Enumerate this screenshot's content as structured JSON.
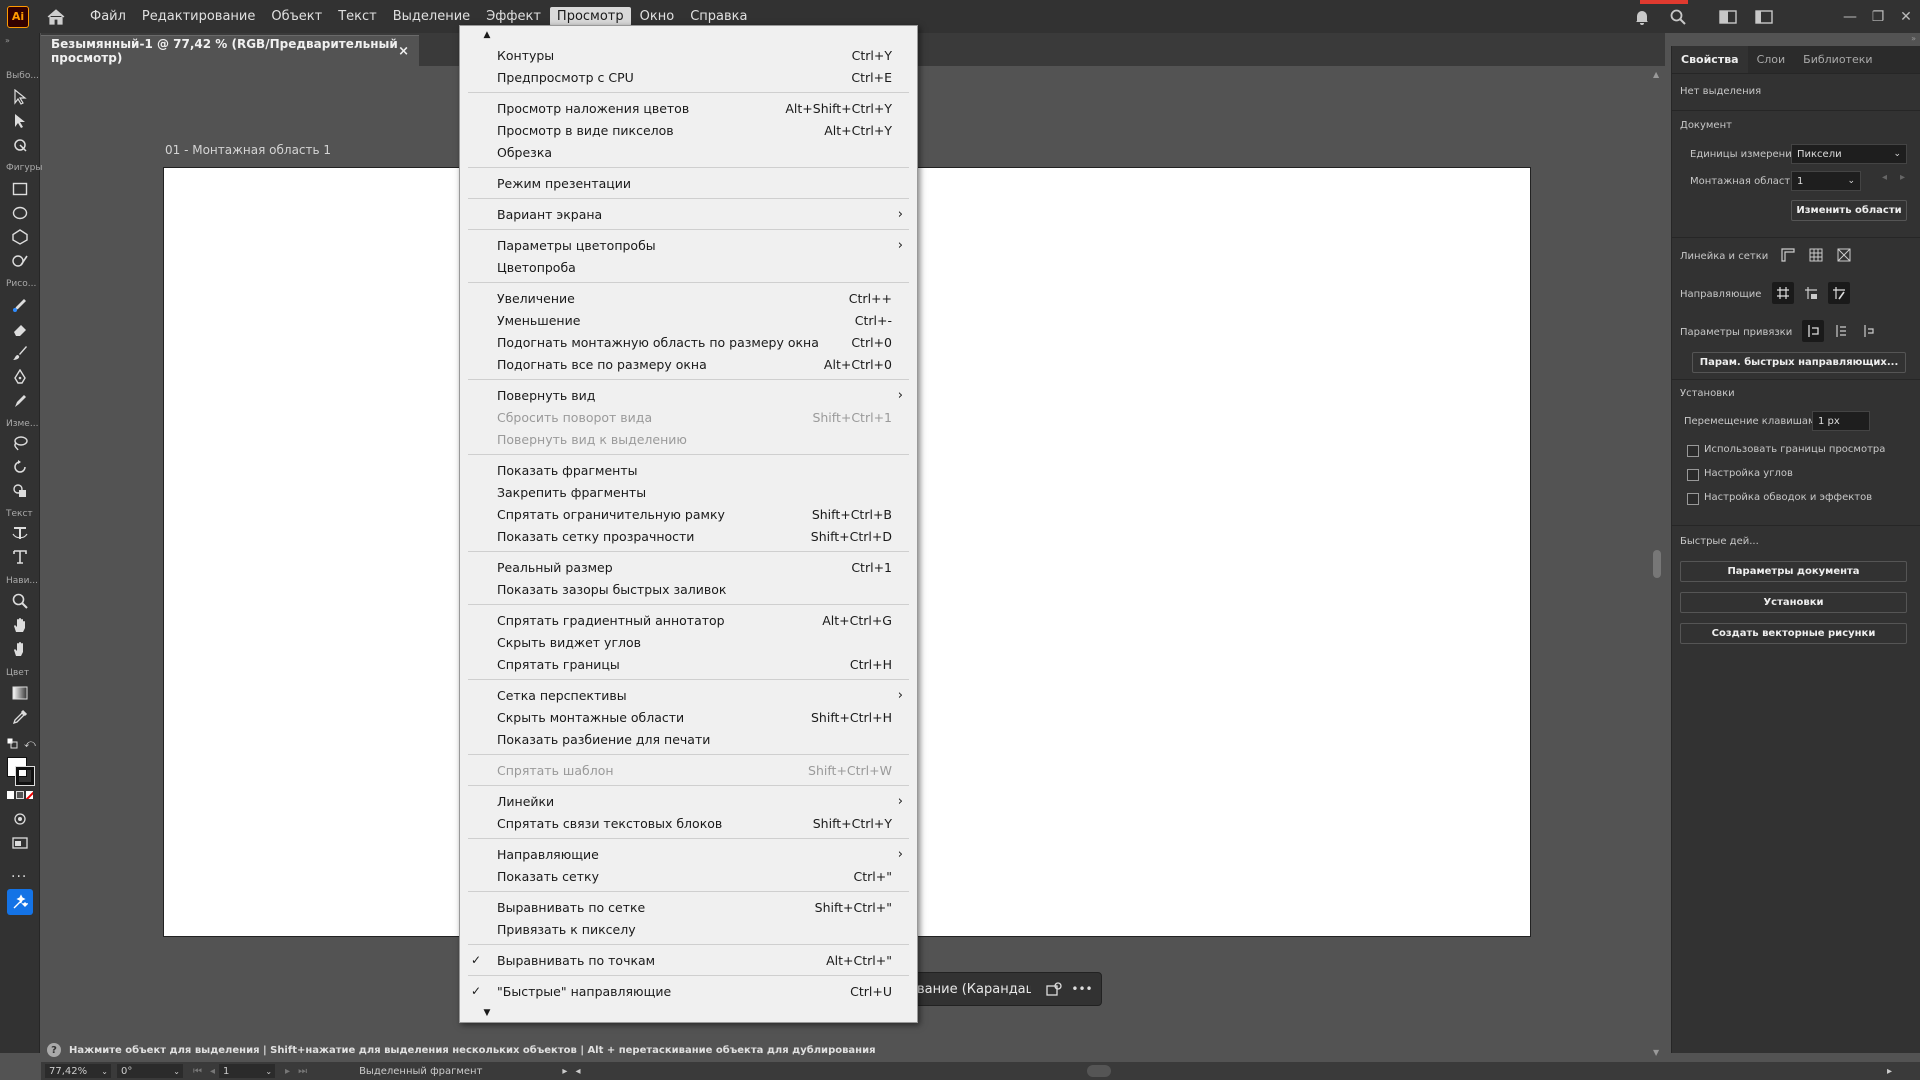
{
  "app": {
    "logo": "Ai",
    "menu": [
      "Файл",
      "Редактирование",
      "Объект",
      "Текст",
      "Выделение",
      "Эффект",
      "Просмотр",
      "Окно",
      "Справка"
    ],
    "active_menu_index": 6,
    "accent_color": "#ff9a00"
  },
  "document": {
    "tab_title": "Безымянный-1 @ 77,42 % (RGB/Предварительный просмотр)",
    "tab_close": "×",
    "artboard_label": "01 - Монтажная область 1"
  },
  "toolbar": {
    "sections": [
      "Выбо...",
      "Фигуры",
      "Рисо...",
      "Изме...",
      "Текст",
      "Нави...",
      "Цвет"
    ],
    "more": "..."
  },
  "task_bar": {
    "label": "вание (Карандаш)",
    "more": "•••"
  },
  "view_menu": {
    "items": [
      {
        "label": "Контуры",
        "shortcut": "Ctrl+Y"
      },
      {
        "label": "Предпросмотр с CPU",
        "shortcut": "Ctrl+E"
      },
      {
        "label": "Просмотр наложения цветов",
        "shortcut": "Alt+Shift+Ctrl+Y"
      },
      {
        "label": "Просмотр в виде пикселов",
        "shortcut": "Alt+Ctrl+Y"
      },
      {
        "label": "Обрезка",
        "shortcut": ""
      },
      {
        "label": "Режим презентации",
        "shortcut": ""
      },
      {
        "label": "Вариант экрана",
        "shortcut": "",
        "submenu": true
      },
      {
        "label": "Параметры цветопробы",
        "shortcut": "",
        "submenu": true
      },
      {
        "label": "Цветопроба",
        "shortcut": ""
      },
      {
        "label": "Увеличение",
        "shortcut": "Ctrl++"
      },
      {
        "label": "Уменьшение",
        "shortcut": "Ctrl+-"
      },
      {
        "label": "Подогнать монтажную область по размеру окна",
        "shortcut": "Ctrl+0"
      },
      {
        "label": "Подогнать все по размеру окна",
        "shortcut": "Alt+Ctrl+0"
      },
      {
        "label": "Повернуть вид",
        "shortcut": "",
        "submenu": true
      },
      {
        "label": "Сбросить поворот вида",
        "shortcut": "Shift+Ctrl+1",
        "disabled": true
      },
      {
        "label": "Повернуть вид к выделению",
        "shortcut": "",
        "disabled": true
      },
      {
        "label": "Показать фрагменты",
        "shortcut": ""
      },
      {
        "label": "Закрепить фрагменты",
        "shortcut": ""
      },
      {
        "label": "Спрятать ограничительную рамку",
        "shortcut": "Shift+Ctrl+B"
      },
      {
        "label": "Показать сетку прозрачности",
        "shortcut": "Shift+Ctrl+D"
      },
      {
        "label": "Реальный размер",
        "shortcut": "Ctrl+1"
      },
      {
        "label": "Показать зазоры быстрых заливок",
        "shortcut": ""
      },
      {
        "label": "Спрятать градиентный аннотатор",
        "shortcut": "Alt+Ctrl+G"
      },
      {
        "label": "Скрыть виджет углов",
        "shortcut": ""
      },
      {
        "label": "Спрятать границы",
        "shortcut": "Ctrl+H"
      },
      {
        "label": "Сетка перспективы",
        "shortcut": "",
        "submenu": true
      },
      {
        "label": "Скрыть монтажные области",
        "shortcut": "Shift+Ctrl+H"
      },
      {
        "label": "Показать разбиение для печати",
        "shortcut": ""
      },
      {
        "label": "Спрятать шаблон",
        "shortcut": "Shift+Ctrl+W",
        "disabled": true
      },
      {
        "label": "Линейки",
        "shortcut": "",
        "submenu": true
      },
      {
        "label": "Спрятать связи текстовых блоков",
        "shortcut": "Shift+Ctrl+Y"
      },
      {
        "label": "Направляющие",
        "shortcut": "",
        "submenu": true
      },
      {
        "label": "Показать сетку",
        "shortcut": "Ctrl+\""
      },
      {
        "label": "Выравнивать по сетке",
        "shortcut": "Shift+Ctrl+\""
      },
      {
        "label": "Привязать к пикселу",
        "shortcut": ""
      },
      {
        "label": "Выравнивать по точкам",
        "shortcut": "Alt+Ctrl+\"",
        "checked": true
      },
      {
        "label": "\"Быстрые\" направляющие",
        "shortcut": "Ctrl+U",
        "checked": true
      }
    ],
    "checkmark": "✓",
    "submenu_arrow": "›"
  },
  "properties_panel": {
    "tabs": [
      "Свойства",
      "Слои",
      "Библиотеки"
    ],
    "no_selection": "Нет выделения",
    "document_heading": "Документ",
    "units_label": "Единицы измерения:",
    "units_value": "Пиксели",
    "artboard_label": "Монтажная область:",
    "artboard_value": "1",
    "edit_artboards_button": "Изменить области",
    "rulers_grids_label": "Линейка и сетки",
    "guides_label": "Направляющие",
    "snap_options_label": "Параметры привязки",
    "smart_guides_button": "Парам. быстрых направляющих...",
    "preferences_heading": "Установки",
    "keyboard_increment_label": "Перемещение клавишами:",
    "keyboard_increment_value": "1 px",
    "checkbox_preview_bounds": "Использовать границы просмотра",
    "checkbox_scale_corners": "Настройка углов",
    "checkbox_scale_strokes": "Настройка обводок и эффектов",
    "quick_actions_heading": "Быстрые дей...",
    "doc_setup_button": "Параметры документа",
    "preferences_button": "Установки",
    "vectorize_button": "Создать векторные рисунки"
  },
  "status": {
    "hint_icon": "?",
    "hint": "Нажмите объект для выделения  |  Shift+нажатие для выделения нескольких объектов  |  Alt + перетаскивание объекта для дублирования",
    "zoom": "77,42%",
    "rotation": "0°",
    "artboard_num": "1",
    "selection_tool": "Выделенный фрагмент"
  }
}
